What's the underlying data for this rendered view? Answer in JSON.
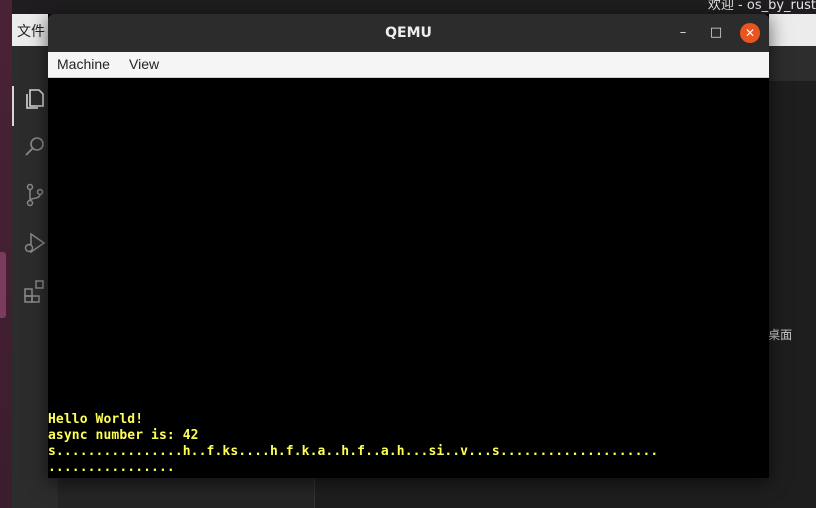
{
  "desktop": {
    "top_bar_text": "欢迎 - os_by_rust"
  },
  "vscode": {
    "menu": [
      "文件"
    ],
    "path_fragment": "~/桌面",
    "activity_icons": [
      "explorer-icon",
      "search-icon",
      "source-control-icon",
      "run-debug-icon",
      "extensions-icon"
    ]
  },
  "qemu": {
    "title": "QEMU",
    "controls": {
      "minimize": "–",
      "maximize": "□",
      "close": "✕"
    },
    "menu": {
      "machine": "Machine",
      "view": "View"
    },
    "console": {
      "lines": [
        "Hello World!",
        "async number is: 42",
        "s................h..f.ks....h.f.k.a..h.f..a.h...si..v...s....................",
        "................"
      ],
      "text_color": "#ffff55"
    }
  },
  "colors": {
    "close_button": "#e95420",
    "titlebar": "#2c2c2c",
    "console_background": "#000000"
  }
}
